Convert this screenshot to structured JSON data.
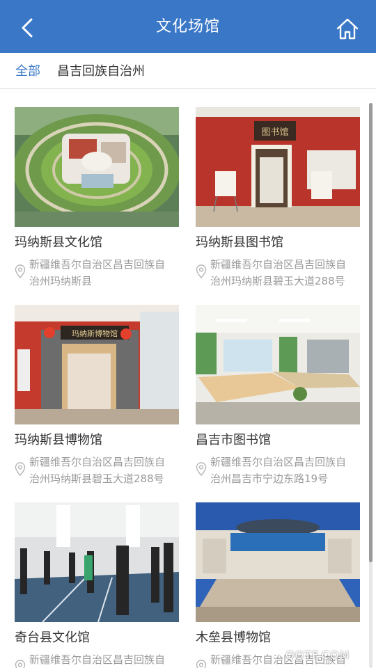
{
  "header": {
    "title": "文化场馆",
    "back_icon": "chevron-left-icon",
    "home_icon": "home-icon"
  },
  "filter": {
    "all_label": "全部",
    "region_label": "昌吉回族自治州"
  },
  "venues": [
    {
      "name": "玛纳斯县文化馆",
      "address_line1": "新疆维吾尔自治区昌吉回族自",
      "address_line2": "治州玛纳斯县"
    },
    {
      "name": "玛纳斯县图书馆",
      "address_line1": "新疆维吾尔自治区昌吉回族自",
      "address_line2": "治州玛纳斯县碧玉大道288号"
    },
    {
      "name": "玛纳斯县博物馆",
      "address_line1": "新疆维吾尔自治区昌吉回族自",
      "address_line2": "治州玛纳斯县碧玉大道288号"
    },
    {
      "name": "昌吉市图书馆",
      "address_line1": "新疆维吾尔自治区昌吉回族自",
      "address_line2": "治州昌吉市宁边东路19号"
    },
    {
      "name": "奇台县文化馆",
      "address_line1": "新疆维吾尔自治区昌吉回族自",
      "address_line2": ""
    },
    {
      "name": "木垒县博物馆",
      "address_line1": "新疆维吾尔自治区昌吉回族自",
      "address_line2": ""
    }
  ],
  "photo_signs": {
    "library_sign": "图书馆",
    "museum_sign": "玛纳斯博物馆"
  },
  "watermark": "QQTF.COM",
  "colors": {
    "header_bg": "#3a78c7",
    "accent": "#3a78c7",
    "muted_text": "#9a9a9a"
  }
}
